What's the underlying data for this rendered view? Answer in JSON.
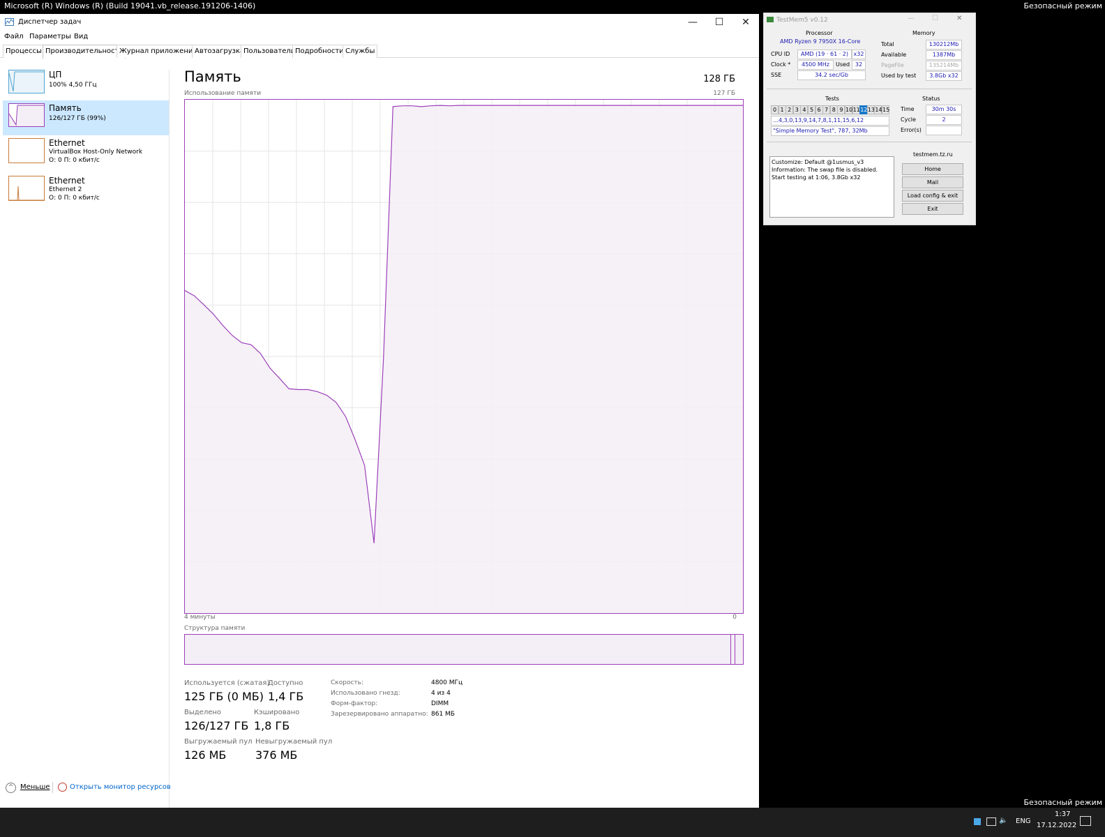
{
  "desktop": {
    "top_title": "Microsoft (R) Windows (R) (Build 19041.vb_release.191206-1406)",
    "safe_mode_top": "Безопасный режим",
    "safe_mode_bottom": "Безопасный режим"
  },
  "taskmgr": {
    "title": "Диспетчер задач",
    "window_buttons": {
      "minimize": "—",
      "maximize": "☐",
      "close": "✕"
    },
    "menu": [
      "Файл",
      "Параметры",
      "Вид"
    ],
    "tabs": [
      "Процессы",
      "Производительность",
      "Журнал приложений",
      "Автозагрузка",
      "Пользователи",
      "Подробности",
      "Службы"
    ],
    "active_tab_index": 1,
    "sidebar": [
      {
        "name": "ЦП",
        "sub1": "100%  4,50 ГГц",
        "sub2": ""
      },
      {
        "name": "Память",
        "sub1": "126/127 ГБ (99%)",
        "sub2": ""
      },
      {
        "name": "Ethernet",
        "sub1": "VirtualBox Host-Only Network",
        "sub2": "О: 0 П: 0 кбит/с"
      },
      {
        "name": "Ethernet",
        "sub1": "Ethernet 2",
        "sub2": "О: 0 П: 0 кбит/с"
      }
    ],
    "main": {
      "title": "Память",
      "total": "128 ГБ",
      "usage_label": "Использование памяти",
      "usage_max": "127 ГБ",
      "time_left": "4 минуты",
      "time_right": "0",
      "composition_label": "Структура памяти",
      "accent": "#9b3fb9"
    },
    "stats": {
      "in_use_label": "Используется (сжатая)",
      "in_use_value": "125 ГБ (0 МБ)",
      "available_label": "Доступно",
      "available_value": "1,4 ГБ",
      "committed_label": "Выделено",
      "committed_value": "126/127 ГБ",
      "cached_label": "Кэшировано",
      "cached_value": "1,8 ГБ",
      "paged_label": "Выгружаемый пул",
      "paged_value": "126 МБ",
      "nonpaged_label": "Невыгружаемый пул",
      "nonpaged_value": "376 МБ"
    },
    "info": [
      {
        "label": "Скорость:",
        "value": "4800 МГц"
      },
      {
        "label": "Использовано гнезд:",
        "value": "4 из 4"
      },
      {
        "label": "Форм-фактор:",
        "value": "DIMM"
      },
      {
        "label": "Зарезервировано аппаратно:",
        "value": "861 МБ"
      }
    ],
    "bottom": {
      "fewer": "Меньше",
      "resmon": "Открыть монитор ресурсов"
    }
  },
  "testmem": {
    "title": "TestMem5 v0.12",
    "processor_hdr": "Processor",
    "cpu_name": "AMD Ryzen 9 7950X 16-Core",
    "cpuid_label": "CPU ID",
    "cpuid_value": "AMD  (19 · 61 · 2)",
    "cpuid_threads": "x32",
    "clock_label": "Clock *",
    "clock_value": "4500 MHz",
    "used_label": "Used",
    "used_value": "32",
    "sse_label": "SSE",
    "sse_value": "34.2 sec/Gb",
    "memory_hdr": "Memory",
    "total_label": "Total",
    "total_value": "130212Mb",
    "available_label": "Available",
    "available_value": "1387Mb",
    "pagefile_label": "PageFile",
    "pagefile_value": "135214Mb",
    "usedbytest_label": "Used by test",
    "usedbytest_value": "3.8Gb x32",
    "tests_hdr": "Tests",
    "tests": [
      "0",
      "1",
      "2",
      "3",
      "4",
      "5",
      "6",
      "7",
      "8",
      "9",
      "10",
      "11",
      "12",
      "13",
      "14",
      "15"
    ],
    "active_test": "12",
    "tests_order": "…4,3,0,13,9,14,7,8,1,11,15,6,12",
    "current_test": "\"Simple Memory Test\", 787, 32Mb",
    "status_hdr": "Status",
    "time_label": "Time",
    "time_value": "30m 30s",
    "cycle_label": "Cycle",
    "cycle_value": "2",
    "errors_label": "Error(s)",
    "errors_value": "",
    "log": [
      "Customize: Default @1usmus_v3",
      "Information: The swap file is disabled.",
      "Start testing at 1:06, 3.8Gb x32"
    ],
    "site_hdr": "testmem.tz.ru",
    "buttons": [
      "Home",
      "Mail",
      "Load config & exit",
      "Exit"
    ]
  },
  "taskbar": {
    "lang": "ENG",
    "time": "1:37",
    "date": "17.12.2022"
  },
  "chart_data": {
    "type": "line",
    "title": "Использование памяти",
    "xlabel": "",
    "ylabel": "",
    "x_range_labels": [
      "4 минуты",
      "0"
    ],
    "ylim": [
      0,
      127
    ],
    "series": [
      {
        "values": [
          79.8,
          78.5,
          76.3,
          74.0,
          71.2,
          68.7,
          66.9,
          66.4,
          64.2,
          60.6,
          58.1,
          55.5,
          55.3,
          55.3,
          54.8,
          53.9,
          52.1,
          48.6,
          42.9,
          36.5,
          17.3,
          63.1,
          125.3,
          125.5,
          125.5,
          125.3,
          125.5,
          125.6,
          125.5,
          125.6,
          125.6,
          125.6,
          125.6,
          125.6,
          125.6,
          125.6,
          125.6,
          125.6,
          125.6,
          125.6,
          125.6,
          125.6,
          125.6,
          125.6,
          125.6,
          125.6,
          125.6,
          125.6,
          125.6,
          125.6,
          125.6,
          125.6,
          125.6,
          125.6,
          125.6,
          125.6,
          125.6,
          125.6,
          125.6,
          125.6
        ]
      }
    ],
    "grid": true,
    "color": "#9b3fb9"
  }
}
